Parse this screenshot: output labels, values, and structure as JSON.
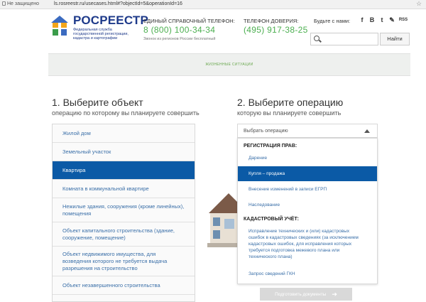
{
  "browser": {
    "security_label": "Не защищено",
    "url": "ls.rosreestr.ru/usecases.html#?objectId=5&operationId=16"
  },
  "header": {
    "logo_title": "РОСРЕЕСТР",
    "logo_subtitle": "Федеральная служба государственной регистрации, кадастра и картографии",
    "helpline_label": "ЕДИНЫЙ СПРАВОЧНЫЙ ТЕЛЕФОН:",
    "helpline_phone": "8 (800) 100-34-34",
    "helpline_note": "Звонок из регионов России бесплатный",
    "trust_label": "ТЕЛЕФОН ДОВЕРИЯ:",
    "trust_phone": "(495) 917-38-25",
    "social_label": "Будьте с нами:",
    "social_icons": [
      "f",
      "В",
      "t",
      "✎",
      "RSS"
    ],
    "search_placeholder": "",
    "search_button": "Найти"
  },
  "nav": {
    "active_section": "ЖИЗНЕННЫЕ СИТУАЦИИ"
  },
  "step1": {
    "title": "1. Выберите объект",
    "subtitle": "операцию по которому вы планируете совершить",
    "items": [
      "Жилой дом",
      "Земельный участок",
      "Квартира",
      "Комната в коммунальной квартире",
      "Нежилые здания, сооружения (кроме линейных), помещения",
      "Объект капитального строительства (здание, сооружение, помещение)",
      "Объект недвижимого имущества, для возведения которого не требуется выдача разрешения на строительство",
      "Объект незавершенного строительства"
    ]
  },
  "step2": {
    "title": "2. Выберите операцию",
    "subtitle": "которую вы планируете совершить",
    "select_placeholder": "Выбрать операцию",
    "group1": "РЕГИСТРАЦИЯ ПРАВ:",
    "group1_items": [
      "Дарение",
      "Купля – продажа",
      "Внесение изменений в записи ЕГРП",
      "Наследование"
    ],
    "group2": "КАДАСТРОВЫЙ УЧЁТ:",
    "group2_items": [
      "Исправление технических и (или) кадастровых ошибок в кадастровых сведениях (за исключением кадастровых ошибок, для исправления которых требуется подготовка межевого плана или технического плана)",
      "Запрос сведений ГКН"
    ]
  },
  "actions": {
    "prepare_button": "Подготовить документы"
  },
  "colors": {
    "brand_blue": "#1e3a8a",
    "active_blue": "#0b5aa6",
    "phone_green": "#4caf50",
    "link_blue": "#3a6fa8"
  }
}
